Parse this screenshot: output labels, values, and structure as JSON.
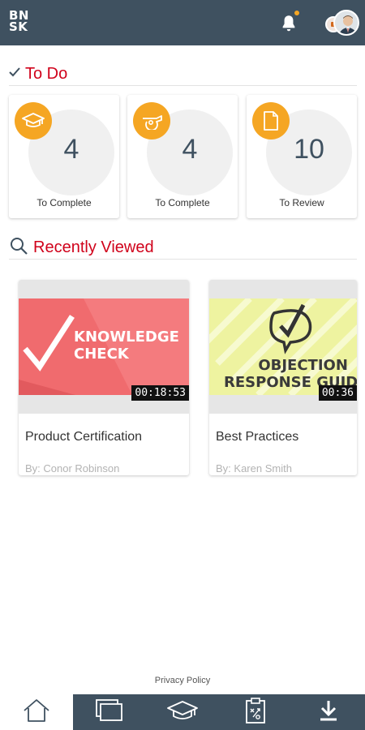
{
  "header": {
    "logo_line1": "BN",
    "logo_line2": "SK",
    "notification_icon": "bell-icon",
    "colors": {
      "bar": "#3f5160",
      "notification_dot": "#f5a623"
    }
  },
  "todo": {
    "title": "To Do",
    "cards": [
      {
        "icon": "graduation-cap-icon",
        "count": "4",
        "label": "To Complete"
      },
      {
        "icon": "whistle-icon",
        "count": "4",
        "label": "To Complete"
      },
      {
        "icon": "document-icon",
        "count": "10",
        "label": "To Review"
      }
    ]
  },
  "recent": {
    "title": "Recently Viewed",
    "cards": [
      {
        "thumb_line1": "KNOWLEDGE",
        "thumb_line2": "CHECK",
        "duration": "00:18:53",
        "title": "Product Certification",
        "author": "By: Conor Robinson"
      },
      {
        "thumb_line1": "OBJECTION",
        "thumb_line2": "RESPONSE GUID",
        "duration": "00:36",
        "title": "Best Practices",
        "author": "By: Karen Smith"
      }
    ]
  },
  "footer": {
    "privacy": "Privacy Policy"
  },
  "bottom_nav": {
    "items": [
      {
        "icon": "home-icon",
        "active": true
      },
      {
        "icon": "library-icon",
        "active": false
      },
      {
        "icon": "courses-icon",
        "active": false
      },
      {
        "icon": "coaching-clipboard-icon",
        "active": false
      },
      {
        "icon": "download-icon",
        "active": false
      }
    ]
  },
  "colors": {
    "accent_red": "#d0021b",
    "badge_orange": "#f5a623",
    "navy": "#3f5160"
  }
}
